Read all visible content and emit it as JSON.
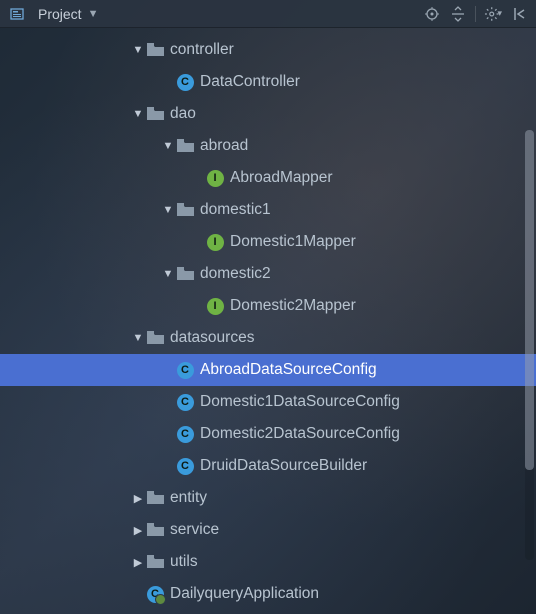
{
  "toolbar": {
    "title": "Project",
    "icons": {
      "pane": "project-pane-icon",
      "target": "locate-icon",
      "collapse": "collapse-all-icon",
      "gear": "settings-icon",
      "hide": "hide-icon"
    }
  },
  "tree": [
    {
      "depth": 3,
      "expand": "down",
      "kind": "folder",
      "label": "controller",
      "selected": false
    },
    {
      "depth": 4,
      "expand": "none",
      "kind": "class",
      "label": "DataController",
      "selected": false
    },
    {
      "depth": 3,
      "expand": "down",
      "kind": "folder",
      "label": "dao",
      "selected": false
    },
    {
      "depth": 4,
      "expand": "down",
      "kind": "folder",
      "label": "abroad",
      "selected": false
    },
    {
      "depth": 5,
      "expand": "none",
      "kind": "interface",
      "label": "AbroadMapper",
      "selected": false
    },
    {
      "depth": 4,
      "expand": "down",
      "kind": "folder",
      "label": "domestic1",
      "selected": false
    },
    {
      "depth": 5,
      "expand": "none",
      "kind": "interface",
      "label": "Domestic1Mapper",
      "selected": false
    },
    {
      "depth": 4,
      "expand": "down",
      "kind": "folder",
      "label": "domestic2",
      "selected": false
    },
    {
      "depth": 5,
      "expand": "none",
      "kind": "interface",
      "label": "Domestic2Mapper",
      "selected": false
    },
    {
      "depth": 3,
      "expand": "down",
      "kind": "folder",
      "label": "datasources",
      "selected": false
    },
    {
      "depth": 4,
      "expand": "none",
      "kind": "class",
      "label": "AbroadDataSourceConfig",
      "selected": true
    },
    {
      "depth": 4,
      "expand": "none",
      "kind": "class",
      "label": "Domestic1DataSourceConfig",
      "selected": false
    },
    {
      "depth": 4,
      "expand": "none",
      "kind": "class",
      "label": "Domestic2DataSourceConfig",
      "selected": false
    },
    {
      "depth": 4,
      "expand": "none",
      "kind": "class",
      "label": "DruidDataSourceBuilder",
      "selected": false
    },
    {
      "depth": 3,
      "expand": "right",
      "kind": "folder",
      "label": "entity",
      "selected": false
    },
    {
      "depth": 3,
      "expand": "right",
      "kind": "folder",
      "label": "service",
      "selected": false
    },
    {
      "depth": 3,
      "expand": "right",
      "kind": "folder",
      "label": "utils",
      "selected": false
    },
    {
      "depth": 3,
      "expand": "none",
      "kind": "app",
      "label": "DailyqueryApplication",
      "selected": false
    }
  ],
  "indent": {
    "base": 130,
    "step": 30
  }
}
